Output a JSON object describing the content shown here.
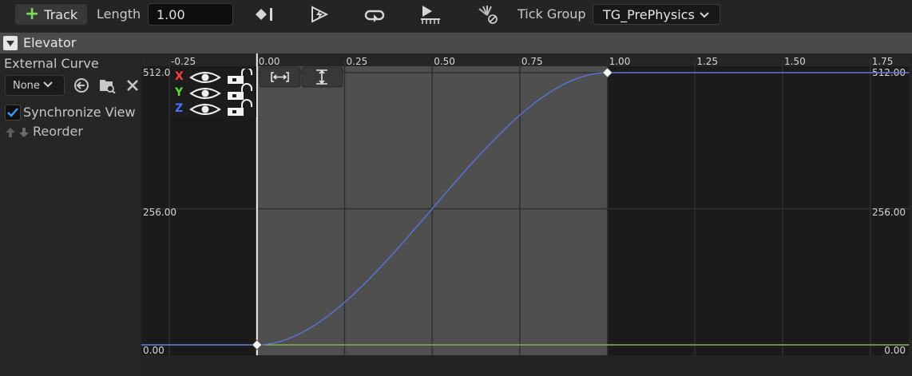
{
  "toolbar": {
    "track_label": "Track",
    "length_label": "Length",
    "length_value": "1.00",
    "tick_group_label": "Tick Group",
    "tick_group_value": "TG_PrePhysics"
  },
  "track": {
    "name": "Elevator"
  },
  "left_panel": {
    "external_curve_label": "External Curve",
    "curve_select_value": "None",
    "synchronize_view_label": "Synchronize View",
    "synchronize_view_checked": true,
    "reorder_label": "Reorder"
  },
  "axes": {
    "channel_x": "X",
    "channel_y": "Y",
    "channel_z": "Z",
    "x_ticks": [
      "-0.25",
      "0.00",
      "0.25",
      "0.50",
      "0.75",
      "1.00",
      "1.25",
      "1.50",
      "1.75"
    ],
    "y_labels": {
      "top_left": "512.00",
      "mid_left": "256.00",
      "bottom_left": "0.00",
      "top_right": "512.00",
      "mid_right": "256.00",
      "bottom_right": "0.00"
    }
  },
  "colors": {
    "x": "#ff4040",
    "y": "#5fdc3a",
    "z": "#4f6fff",
    "curve": "#5a74d8",
    "flat": "#9ad05a"
  },
  "chart_data": {
    "type": "line",
    "series": [
      {
        "values": [
          [
            0.0,
            0.0
          ],
          [
            1.0,
            512.0
          ]
        ]
      }
    ],
    "keys": [
      [
        0.0,
        0.0
      ],
      [
        1.0,
        512.0
      ]
    ],
    "xlim": [
      -0.33,
      1.86
    ],
    "ylim": [
      0,
      512
    ]
  }
}
